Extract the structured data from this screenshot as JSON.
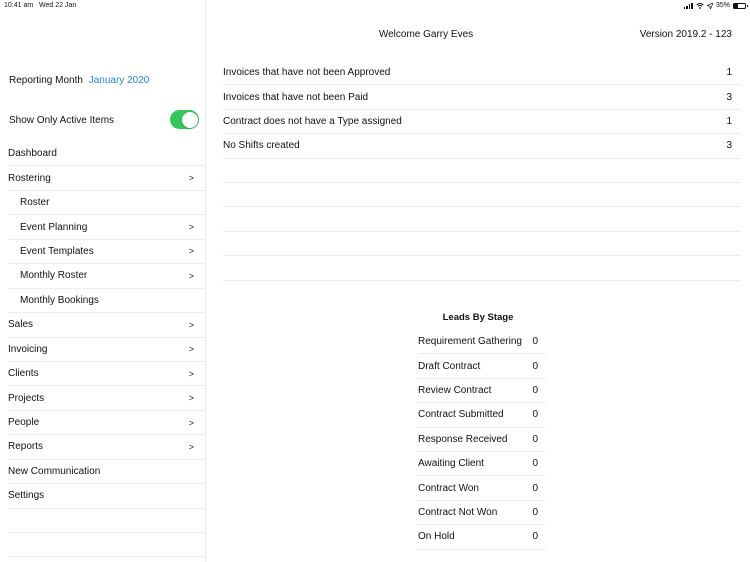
{
  "status_bar": {
    "time": "10:41 am",
    "date": "Wed 22 Jan",
    "battery_percent": "35%",
    "battery_level": 0.35,
    "icons": [
      "signal-icon",
      "wifi-icon",
      "location-icon",
      "battery-icon"
    ]
  },
  "sidebar": {
    "reporting_label": "Reporting Month",
    "reporting_month": "January 2020",
    "active_label": "Show Only Active Items",
    "active_on": true,
    "chevron": ">",
    "items": [
      {
        "label": "Dashboard",
        "sub": false,
        "chevron": false
      },
      {
        "label": "Rostering",
        "sub": false,
        "chevron": true
      },
      {
        "label": "Roster",
        "sub": true,
        "chevron": false
      },
      {
        "label": "Event Planning",
        "sub": true,
        "chevron": true
      },
      {
        "label": "Event Templates",
        "sub": true,
        "chevron": true
      },
      {
        "label": "Monthly Roster",
        "sub": true,
        "chevron": true
      },
      {
        "label": "Monthly Bookings",
        "sub": true,
        "chevron": false
      },
      {
        "label": "Sales",
        "sub": false,
        "chevron": true
      },
      {
        "label": "Invoicing",
        "sub": false,
        "chevron": true
      },
      {
        "label": "Clients",
        "sub": false,
        "chevron": true
      },
      {
        "label": "Projects",
        "sub": false,
        "chevron": true
      },
      {
        "label": "People",
        "sub": false,
        "chevron": true
      },
      {
        "label": "Reports",
        "sub": false,
        "chevron": true
      },
      {
        "label": "New Communication",
        "sub": false,
        "chevron": false
      },
      {
        "label": "Settings",
        "sub": false,
        "chevron": false
      },
      {
        "label": "",
        "sub": false,
        "chevron": false
      },
      {
        "label": "",
        "sub": false,
        "chevron": false
      }
    ]
  },
  "header": {
    "welcome": "Welcome Garry Eves",
    "version": "Version 2019.2 - 123"
  },
  "alerts": [
    {
      "label": "Invoices that have not been Approved",
      "count": "1"
    },
    {
      "label": "Invoices that have not been Paid",
      "count": "3"
    },
    {
      "label": "Contract does not have a Type assigned",
      "count": "1"
    },
    {
      "label": "No Shifts created",
      "count": "3"
    },
    {
      "label": "",
      "count": ""
    },
    {
      "label": "",
      "count": ""
    },
    {
      "label": "",
      "count": ""
    },
    {
      "label": "",
      "count": ""
    },
    {
      "label": "",
      "count": ""
    }
  ],
  "leads": {
    "title": "Leads By Stage",
    "rows": [
      {
        "stage": "Requirement Gathering",
        "count": "0"
      },
      {
        "stage": "Draft Contract",
        "count": "0"
      },
      {
        "stage": "Review Contract",
        "count": "0"
      },
      {
        "stage": "Contract Submitted",
        "count": "0"
      },
      {
        "stage": "Response Received",
        "count": "0"
      },
      {
        "stage": "Awaiting Client",
        "count": "0"
      },
      {
        "stage": "Contract Won",
        "count": "0"
      },
      {
        "stage": "Contract Not Won",
        "count": "0"
      },
      {
        "stage": "On Hold",
        "count": "0"
      }
    ]
  },
  "colors": {
    "accent": "#2a86d8",
    "toggle_on": "#34c759",
    "divider": "#ececec"
  }
}
